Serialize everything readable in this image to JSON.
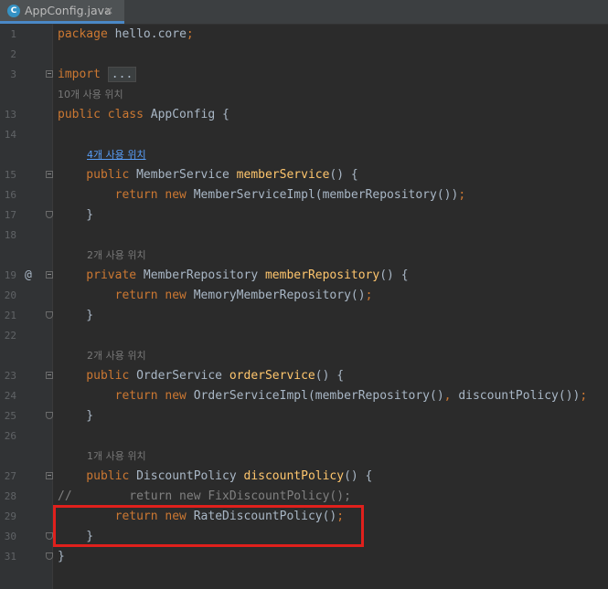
{
  "tab": {
    "icon_letter": "C",
    "filename": "AppConfig.java",
    "close_glyph": "✕"
  },
  "lines": [
    {
      "n": "1",
      "code": [
        [
          "kw",
          "package "
        ],
        [
          "",
          "hello.core"
        ],
        [
          "kw",
          ";"
        ]
      ]
    },
    {
      "n": "2",
      "code": []
    },
    {
      "n": "3",
      "code": [
        [
          "kw",
          "import "
        ],
        [
          "fold",
          "..."
        ]
      ]
    },
    {
      "hint": "10개 사용 위치"
    },
    {
      "n": "13",
      "code": [
        [
          "kw",
          "public class "
        ],
        [
          "",
          "AppConfig {"
        ]
      ]
    },
    {
      "n": "14",
      "code": []
    },
    {
      "hint": "4개 사용 위치",
      "link": true,
      "indent": 1
    },
    {
      "n": "15",
      "code": [
        [
          "kw",
          "    public "
        ],
        [
          "",
          "MemberService "
        ],
        [
          "fn",
          "memberService"
        ],
        [
          "",
          "() {"
        ]
      ]
    },
    {
      "n": "16",
      "code": [
        [
          "kw",
          "        return new "
        ],
        [
          "",
          "MemberServiceImpl(memberRepository())"
        ],
        [
          "kw",
          ";"
        ]
      ]
    },
    {
      "n": "17",
      "code": [
        [
          "",
          "    }"
        ]
      ]
    },
    {
      "n": "18",
      "code": []
    },
    {
      "hint": "2개 사용 위치",
      "indent": 1
    },
    {
      "n": "19",
      "marker": "@",
      "code": [
        [
          "kw",
          "    private "
        ],
        [
          "",
          "MemberRepository "
        ],
        [
          "fn",
          "memberRepository"
        ],
        [
          "",
          "() {"
        ]
      ]
    },
    {
      "n": "20",
      "code": [
        [
          "kw",
          "        return new "
        ],
        [
          "",
          "MemoryMemberRepository()"
        ],
        [
          "kw",
          ";"
        ]
      ]
    },
    {
      "n": "21",
      "code": [
        [
          "",
          "    }"
        ]
      ]
    },
    {
      "n": "22",
      "code": []
    },
    {
      "hint": "2개 사용 위치",
      "indent": 1
    },
    {
      "n": "23",
      "code": [
        [
          "kw",
          "    public "
        ],
        [
          "",
          "OrderService "
        ],
        [
          "fn",
          "orderService"
        ],
        [
          "",
          "() {"
        ]
      ]
    },
    {
      "n": "24",
      "code": [
        [
          "kw",
          "        return new "
        ],
        [
          "",
          "OrderServiceImpl(memberRepository()"
        ],
        [
          "kw",
          ", "
        ],
        [
          "",
          "discountPolicy())"
        ],
        [
          "kw",
          ";"
        ]
      ]
    },
    {
      "n": "25",
      "code": [
        [
          "",
          "    }"
        ]
      ]
    },
    {
      "n": "26",
      "code": []
    },
    {
      "hint": "1개 사용 위치",
      "indent": 1
    },
    {
      "n": "27",
      "code": [
        [
          "kw",
          "    public "
        ],
        [
          "",
          "DiscountPolicy "
        ],
        [
          "fn",
          "discountPolicy"
        ],
        [
          "",
          "() {"
        ]
      ]
    },
    {
      "n": "28",
      "code": [
        [
          "cm",
          "//        return new FixDiscountPolicy();"
        ]
      ]
    },
    {
      "n": "29",
      "code": [
        [
          "kw",
          "        return new "
        ],
        [
          "",
          "RateDiscountPolicy()"
        ],
        [
          "kw",
          ";"
        ]
      ]
    },
    {
      "n": "30",
      "code": [
        [
          "",
          "    }"
        ]
      ]
    },
    {
      "n": "31",
      "code": [
        [
          "",
          "}"
        ]
      ]
    }
  ],
  "colors": {
    "keyword": "#cc7832",
    "method": "#ffc66d",
    "comment": "#808080",
    "text": "#a9b7c6",
    "background": "#2b2b2b",
    "highlight": "#e0201c"
  }
}
